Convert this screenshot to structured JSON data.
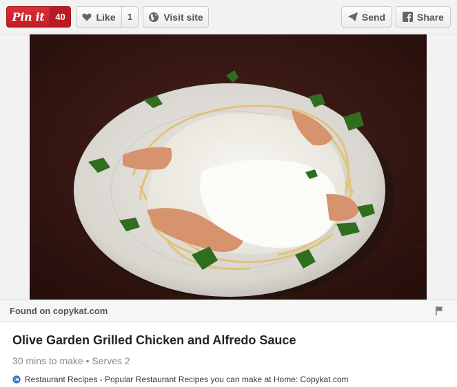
{
  "toolbar": {
    "pin_label": "Pin it",
    "pin_count": "40",
    "like_label": "Like",
    "like_count": "1",
    "visit_label": "Visit site",
    "send_label": "Send",
    "share_label": "Share"
  },
  "found_on": "Found on copykat.com",
  "recipe": {
    "title": "Olive Garden Grilled Chicken and Alfredo Sauce",
    "time": "30 mins to make",
    "separator": "•",
    "serves": "Serves 2"
  },
  "source_line": "Restaurant Recipes - Popular Restaurant Recipes you can make at Home: Copykat.com",
  "colors": {
    "pin_red": "#cb2027",
    "toolbar_bg": "#f2f2f2"
  }
}
